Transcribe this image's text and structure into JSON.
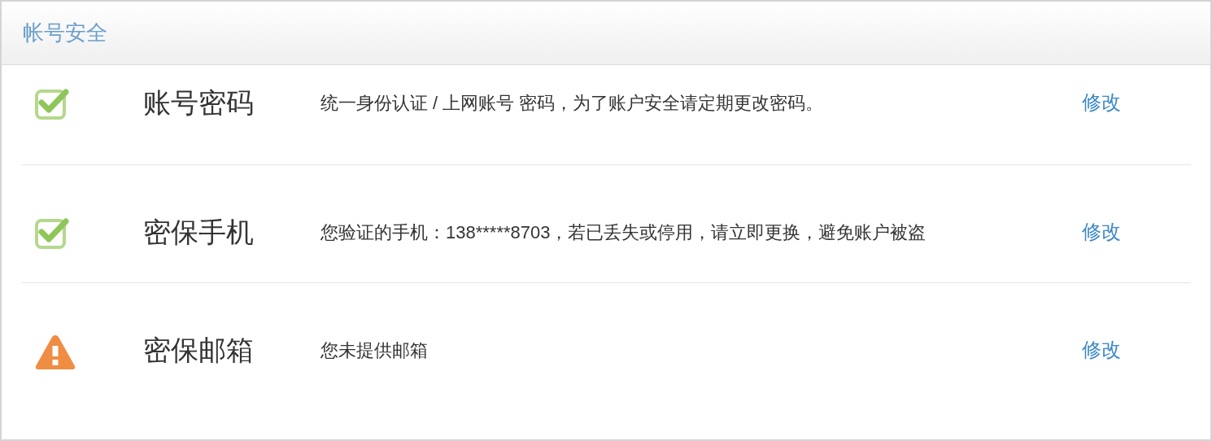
{
  "panel": {
    "title": "帐号安全"
  },
  "items": [
    {
      "kind": "verified",
      "name": "账号密码",
      "description": "统一身份认证 / 上网账号 密码，为了账户安全请定期更改密码。",
      "action": "修改"
    },
    {
      "kind": "verified",
      "name": "密保手机",
      "description": "您验证的手机：138*****8703，若已丢失或停用，请立即更换，避免账户被盗",
      "action": "修改"
    },
    {
      "kind": "warning",
      "name": "密保邮箱",
      "description": "您未提供邮箱",
      "action": "修改"
    }
  ]
}
